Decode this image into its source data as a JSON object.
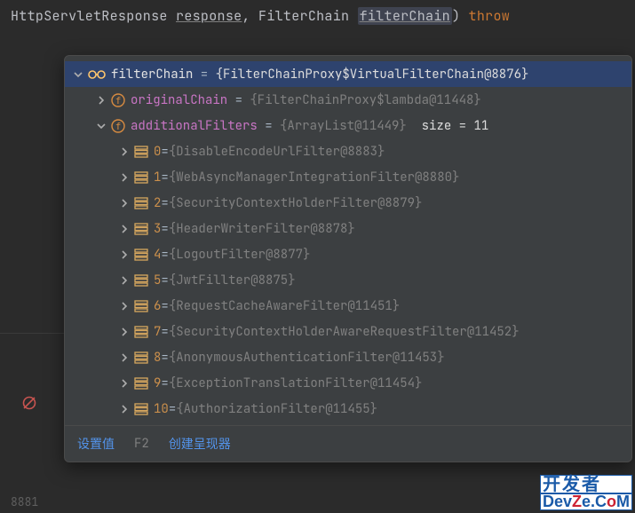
{
  "code": {
    "t1": "HttpServletResponse ",
    "t2": "response",
    "t3": ", FilterChain ",
    "t4": "filterChain",
    "t5": ") ",
    "t6": "throw"
  },
  "tree": {
    "root": {
      "name": "filterChain",
      "value": "{FilterChainProxy$VirtualFilterChain@8876}"
    },
    "originalChain": {
      "name": "originalChain",
      "value": "{FilterChainProxy$lambda@11448}"
    },
    "additionalFilters": {
      "name": "additionalFilters",
      "value": "{ArrayList@11449}",
      "sizeLabel": "size = 11"
    },
    "items": [
      {
        "idx": "0",
        "value": "{DisableEncodeUrlFilter@8883}"
      },
      {
        "idx": "1",
        "value": "{WebAsyncManagerIntegrationFilter@8880}"
      },
      {
        "idx": "2",
        "value": "{SecurityContextHolderFilter@8879}"
      },
      {
        "idx": "3",
        "value": "{HeaderWriterFilter@8878}"
      },
      {
        "idx": "4",
        "value": "{LogoutFilter@8877}"
      },
      {
        "idx": "5",
        "value": "{JwtFillter@8875}"
      },
      {
        "idx": "6",
        "value": "{RequestCacheAwareFilter@11451}"
      },
      {
        "idx": "7",
        "value": "{SecurityContextHolderAwareRequestFilter@11452}"
      },
      {
        "idx": "8",
        "value": "{AnonymousAuthenticationFilter@11453}"
      },
      {
        "idx": "9",
        "value": "{ExceptionTranslationFilter@11454}"
      },
      {
        "idx": "10",
        "value": "{AuthorizationFilter@11455}"
      }
    ]
  },
  "footer": {
    "setValue": "设置值",
    "f2": "F2",
    "createRenderer": "创建呈现器"
  },
  "gutter": {
    "lineNum": "8881"
  },
  "watermark": {
    "top": "开发者",
    "bot1": "Dev",
    "bot2": "Z",
    "bot3": "e",
    "bot4": ".C",
    "bot5": "o",
    "bot6": "M"
  }
}
